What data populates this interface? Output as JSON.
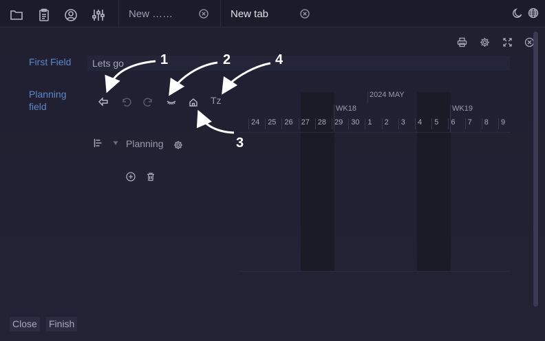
{
  "toolbar": {
    "icons": [
      "folder-icon",
      "clipboard-icon",
      "user-circle-icon",
      "sliders-icon"
    ]
  },
  "tabs": [
    {
      "label": "New ……",
      "active": false
    },
    {
      "label": "New tab",
      "active": true
    }
  ],
  "topbar_right": [
    "moon-icon",
    "globe-icon"
  ],
  "window_controls": [
    "print-icon",
    "gear-icon",
    "expand-icon",
    "close-circle-icon"
  ],
  "form": {
    "first_field": {
      "label": "First Field",
      "value": "Lets go"
    },
    "planning_field": {
      "label_line1": "Planning",
      "label_line2": "field"
    }
  },
  "planning_toolbar": {
    "icons": [
      "back-arrow-icon",
      "undo-icon",
      "redo-icon",
      "eye-closed-icon",
      "home-icon"
    ],
    "tz_label": "Tz"
  },
  "annotations": [
    "1",
    "2",
    "3",
    "4"
  ],
  "planning_tree": {
    "label": "Planning",
    "actions": [
      "add-circle-icon",
      "trash-icon"
    ]
  },
  "timeline": {
    "month_label": "2024  MAY",
    "weeks": [
      "WK18",
      "WK19"
    ],
    "days": [
      "24",
      "25",
      "26",
      "27",
      "28",
      "29",
      "30",
      "1",
      "2",
      "3",
      "4",
      "5",
      "6",
      "7",
      "8",
      "9"
    ]
  },
  "footer": {
    "close_label": "Close",
    "finish_label": "Finish"
  }
}
